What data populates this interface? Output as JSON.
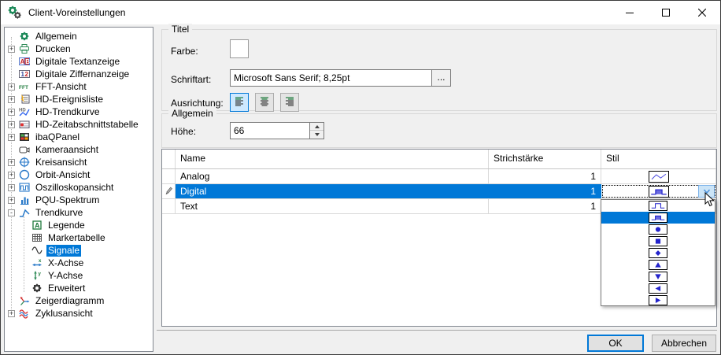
{
  "window": {
    "title": "Client-Voreinstellungen",
    "controls": [
      "minimize",
      "maximize",
      "close"
    ]
  },
  "tree": {
    "items": [
      {
        "label": "Allgemein",
        "icon": "gear-green",
        "expander": null,
        "child": false,
        "selected": false
      },
      {
        "label": "Drucken",
        "icon": "printer",
        "expander": "+",
        "child": false,
        "selected": false
      },
      {
        "label": "Digitale Textanzeige",
        "icon": "text-display",
        "expander": null,
        "child": false,
        "selected": false
      },
      {
        "label": "Digitale Ziffernanzeige",
        "icon": "digit-display",
        "expander": null,
        "child": false,
        "selected": false
      },
      {
        "label": "FFT-Ansicht",
        "icon": "fft",
        "expander": "+",
        "child": false,
        "selected": false
      },
      {
        "label": "HD-Ereignisliste",
        "icon": "event-list",
        "expander": "+",
        "child": false,
        "selected": false
      },
      {
        "label": "HD-Trendkurve",
        "icon": "hd-trend",
        "expander": "+",
        "child": false,
        "selected": false
      },
      {
        "label": "HD-Zeitabschnittstabelle",
        "icon": "hd-table",
        "expander": "+",
        "child": false,
        "selected": false
      },
      {
        "label": "ibaQPanel",
        "icon": "qpanel",
        "expander": "+",
        "child": false,
        "selected": false
      },
      {
        "label": "Kameraansicht",
        "icon": "camera",
        "expander": null,
        "child": false,
        "selected": false
      },
      {
        "label": "Kreisansicht",
        "icon": "circle-cross",
        "expander": "+",
        "child": false,
        "selected": false
      },
      {
        "label": "Orbit-Ansicht",
        "icon": "orbit",
        "expander": "+",
        "child": false,
        "selected": false
      },
      {
        "label": "Oszilloskopansicht",
        "icon": "scope",
        "expander": "+",
        "child": false,
        "selected": false
      },
      {
        "label": "PQU-Spektrum",
        "icon": "spectrum",
        "expander": "+",
        "child": false,
        "selected": false
      },
      {
        "label": "Trendkurve",
        "icon": "trend",
        "expander": "-",
        "child": false,
        "selected": false
      },
      {
        "label": "Legende",
        "icon": "legend-a",
        "expander": null,
        "child": true,
        "selected": false
      },
      {
        "label": "Markertabelle",
        "icon": "marker-table",
        "expander": null,
        "child": true,
        "selected": false
      },
      {
        "label": "Signale",
        "icon": "sine",
        "expander": null,
        "child": true,
        "selected": true
      },
      {
        "label": "X-Achse",
        "icon": "x-axis",
        "expander": null,
        "child": true,
        "selected": false
      },
      {
        "label": "Y-Achse",
        "icon": "y-axis",
        "expander": null,
        "child": true,
        "selected": false
      },
      {
        "label": "Erweitert",
        "icon": "gear-dark",
        "expander": null,
        "child": true,
        "selected": false
      },
      {
        "label": "Zeigerdiagramm",
        "icon": "pointer-diagram",
        "expander": null,
        "child": false,
        "selected": false
      },
      {
        "label": "Zyklusansicht",
        "icon": "cycles",
        "expander": "+",
        "child": false,
        "selected": false
      }
    ]
  },
  "titel": {
    "legend": "Titel",
    "farbe_label": "Farbe:",
    "farbe_value": "#000000",
    "schriftart_label": "Schriftart:",
    "schriftart_value": "Microsoft Sans Serif; 8,25pt",
    "browse_label": "...",
    "ausrichtung_label": "Ausrichtung:",
    "alignment_options": [
      "left",
      "center",
      "right"
    ],
    "alignment_selected": "left"
  },
  "allgemein": {
    "legend": "Allgemein",
    "hoehe_label": "Höhe:",
    "hoehe_value": "66"
  },
  "signal_table": {
    "columns": [
      "Name",
      "Strichstärke",
      "Stil"
    ],
    "rows": [
      {
        "name": "Analog",
        "strichstaerke": "1",
        "stil": "line",
        "selected": false,
        "editing": false
      },
      {
        "name": "Digital",
        "strichstaerke": "1",
        "stil": "step-filled",
        "selected": true,
        "editing": true
      },
      {
        "name": "Text",
        "strichstaerke": "1",
        "stil": null,
        "selected": false,
        "editing": false
      }
    ]
  },
  "style_dropdown": {
    "open_for_row": "Digital",
    "options": [
      "step-outline",
      "step-filled",
      "circle",
      "square",
      "diamond",
      "triangle-up",
      "triangle-down",
      "triangle-left",
      "triangle-right"
    ],
    "selected": "step-filled"
  },
  "footer": {
    "ok_label": "OK",
    "cancel_label": "Abbrechen"
  },
  "colors": {
    "selection_blue": "#0078d7",
    "shape_blue": "#2424cc",
    "titlebar_bg": "#ffffff",
    "body_bg": "#f0f0f0",
    "title_color_swatch": "#000000"
  }
}
